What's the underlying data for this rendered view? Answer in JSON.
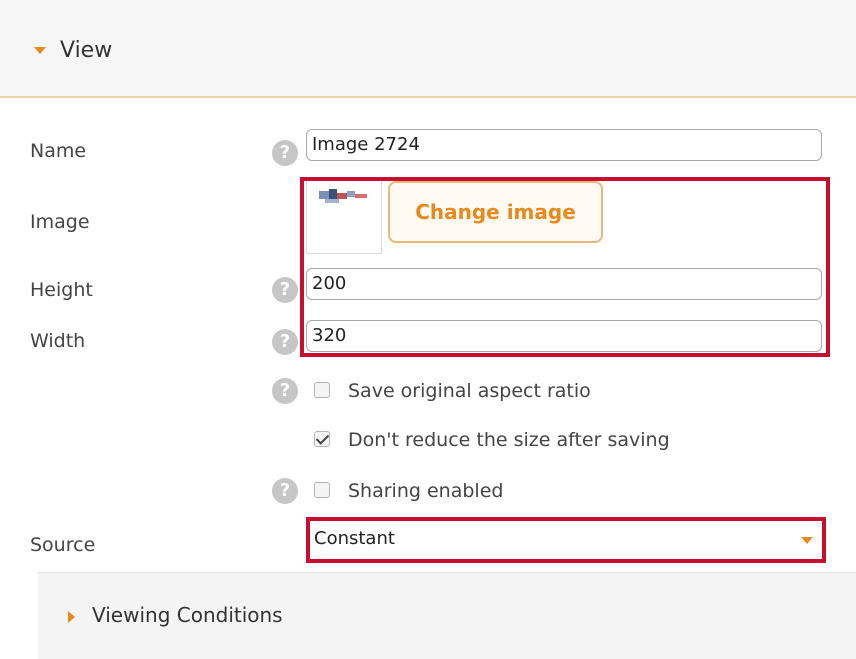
{
  "section": {
    "title": "View"
  },
  "form": {
    "name_label": "Name",
    "name_value": "Image 2724",
    "image_label": "Image",
    "change_image_label": "Change image",
    "height_label": "Height",
    "height_value": "200",
    "width_label": "Width",
    "width_value": "320",
    "save_aspect_label": "Save original aspect ratio",
    "save_aspect_checked": false,
    "dont_reduce_label": "Don't reduce the size after saving",
    "dont_reduce_checked": true,
    "sharing_label": "Sharing enabled",
    "sharing_checked": false,
    "source_label": "Source",
    "source_value": "Constant",
    "help_glyph": "?"
  },
  "subsection": {
    "title": "Viewing Conditions"
  },
  "colors": {
    "accent_orange": "#e8891e",
    "highlight_red": "#c8102e",
    "header_border": "#f0cf9b"
  },
  "icons": [
    "chevron-down-icon",
    "help-icon",
    "image-thumbnail",
    "checkbox",
    "dropdown-arrow-icon",
    "chevron-right-icon"
  ]
}
